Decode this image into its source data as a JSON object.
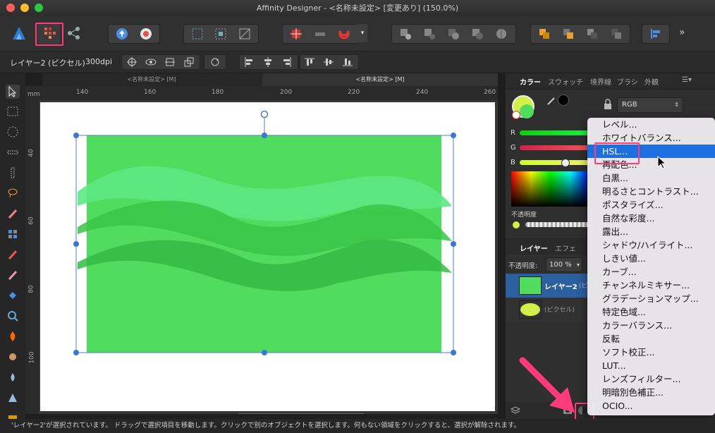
{
  "window": {
    "title": "Affinity Designer - <名称未設定> [変更あり] (150.0%)"
  },
  "context": {
    "layer_name": "レイヤー2 (ピクセル)",
    "dpi": "300dpi"
  },
  "doc_tabs": [
    "<名称未設定> [M]",
    "<名称未設定> [M]"
  ],
  "ruler": {
    "unit": "mm",
    "h_ticks": [
      "140",
      "160",
      "180",
      "200",
      "220",
      "240",
      "260"
    ],
    "v_ticks": [
      "40",
      "60",
      "80",
      "100"
    ]
  },
  "color_panel": {
    "tabs": [
      "カラー",
      "スウォッチ",
      "境界線",
      "ブラシ",
      "外観"
    ],
    "mode": "RGB",
    "slider_labels": [
      "R",
      "G",
      "B"
    ],
    "opacity_label": "不透明度"
  },
  "layers_panel": {
    "tabs": [
      "レイヤー",
      "エフェ"
    ],
    "opacity_label": "不透明度:",
    "opacity_value": "100 %",
    "rows": [
      {
        "name": "レイヤー2",
        "suffix": "(ピ"
      },
      {
        "name": "(ピクセル)"
      }
    ]
  },
  "adjustment_menu": {
    "items": [
      "レベル...",
      "ホワイトバランス...",
      "HSL...",
      "再配色...",
      "白黒...",
      "明るさとコントラスト...",
      "ポスタライズ...",
      "自然な彩度...",
      "露出...",
      "シャドウ/ハイライト...",
      "しきい値...",
      "カーブ...",
      "チャンネルミキサー...",
      "グラデーションマップ...",
      "特定色域...",
      "カラーバランス...",
      "反転",
      "ソフト校正...",
      "LUT...",
      "レンズフィルター...",
      "明暗別色補正...",
      "OCIO..."
    ],
    "selected": "HSL..."
  },
  "status": "'レイヤー2'が選択されています。 ドラッグで選択項目を移動します。クリックで別のオブジェクトを選択します。何もない領域をクリックすると、選択が解除されます。",
  "colors": {
    "accent": "#1d6fe0",
    "highlight": "#ff3b7c",
    "canvas_green": "#4fdc5f"
  }
}
